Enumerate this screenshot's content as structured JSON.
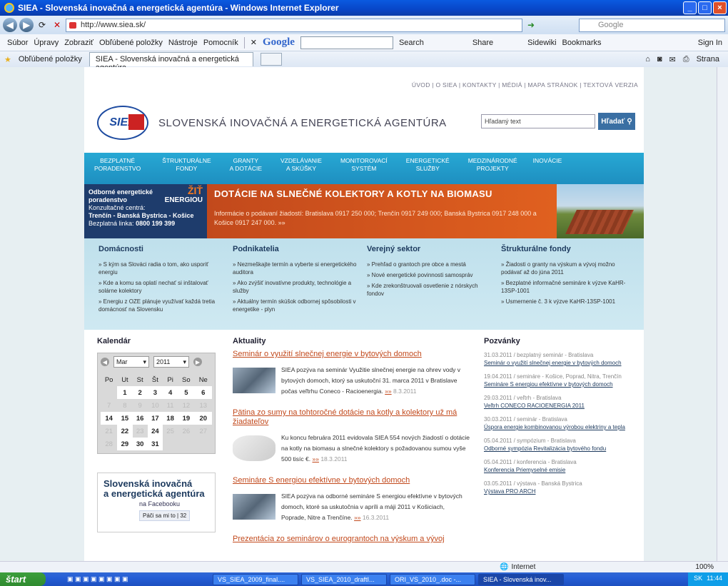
{
  "window": {
    "title": "SIEA - Slovenská inovačná a energetická agentúra - Windows Internet Explorer"
  },
  "address": {
    "url": "http://www.siea.sk/",
    "search_placeholder": "Google"
  },
  "menu": [
    "Súbor",
    "Úpravy",
    "Zobraziť",
    "Obľúbené položky",
    "Nástroje",
    "Pomocník"
  ],
  "google_toolbar": {
    "brand": "Google",
    "search": "Search",
    "share": "Share",
    "sidewiki": "Sidewiki",
    "bookmarks": "Bookmarks",
    "signin": "Sign In"
  },
  "favorites": {
    "label": "Obľúbené položky",
    "tab": "SIEA - Slovenská inovačná a energetická agentúra",
    "page": "Strana"
  },
  "site": {
    "topnav": "ÚVOD | O SIEA | KONTAKTY | MÉDIÁ | MAPA STRÁNOK | TEXTOVÁ VERZIA",
    "logo": "SIEA",
    "org": "SLOVENSKÁ INOVAČNÁ A ENERGETICKÁ AGENTÚRA",
    "search_text": "Hľadaný text",
    "search_btn": "Hľadať",
    "nav": [
      {
        "l1": "BEZPLATNÉ",
        "l2": "PORADENSTVO"
      },
      {
        "l1": "ŠTRUKTURÁLNE",
        "l2": "FONDY"
      },
      {
        "l1": "GRANTY",
        "l2": "A DOTÁCIE"
      },
      {
        "l1": "VZDELÁVANIE",
        "l2": "A SKÚŠKY"
      },
      {
        "l1": "MONITOROVACÍ",
        "l2": "SYSTÉM"
      },
      {
        "l1": "ENERGETICKÉ",
        "l2": "SLUŽBY"
      },
      {
        "l1": "MEDZINÁRODNÉ",
        "l2": "PROJEKTY"
      },
      {
        "l1": "INOVÁCIE",
        "l2": ""
      }
    ],
    "banner_left": {
      "l1": "Odborné energetické",
      "l2": "poradenstvo",
      "l3": "Konzultačné centrá:",
      "l4": "Trenčín - Banská Bystrica - Košice",
      "l5": "Bezplatná linka:",
      "phone": "0800 199 399",
      "zit1": "ŽIŤ",
      "zit2": "ENERGIOU"
    },
    "banner": {
      "title": "DOTÁCIE NA SLNEČNÉ KOLEKTORY A KOTLY NA BIOMASU",
      "text": "Informácie o podávaní žiadostí: Bratislava 0917 250 000; Trenčín 0917 249 000; Banská Bystrica 0917 248 000 a Košice 0917 247 000. »»"
    },
    "sectors": [
      {
        "title": "Domácnosti",
        "items": [
          "» S kým sa Slováci radia o tom, ako usporiť energiu",
          "» Kde a komu sa oplatí nechať si inštalovať solárne kolektory",
          "» Energiu z OZE plánuje využívať každá tretia domácnosť na Slovensku"
        ]
      },
      {
        "title": "Podnikatelia",
        "items": [
          "» Nezmeškajte termín a vyberte si energetického auditora",
          "» Ako zvýšiť inovatívne produkty, technológie a služby",
          "» Aktuálny termín skúšok odbornej spôsobilosti v energetike - plyn"
        ]
      },
      {
        "title": "Verejný sektor",
        "items": [
          "» Prehľad o grantoch pre obce a mestá",
          "» Nové energetické povinnosti samospráv",
          "» Kde zrekonštruovali osvetlenie z nórskych fondov"
        ]
      },
      {
        "title": "Štrukturálne fondy",
        "items": [
          "» Žiadosti o granty na výskum a vývoj možno podávať až do júna 2011",
          "» Bezplatné informačné semináre k výzve KaHR-13SP-1001",
          "» Usmernenie č. 3 k výzve KaHR-13SP-1001"
        ]
      }
    ],
    "calendar": {
      "title": "Kalendár",
      "month": "Mar",
      "year": "2011",
      "weekdays": [
        "Po",
        "Ut",
        "St",
        "Št",
        "Pi",
        "So",
        "Ne"
      ],
      "weeks": [
        [
          "",
          "1",
          "2",
          "3",
          "4",
          "5",
          "6"
        ],
        [
          "7",
          "8",
          "9",
          "10",
          "11",
          "12",
          "13"
        ],
        [
          "14",
          "15",
          "16",
          "17",
          "18",
          "19",
          "20"
        ],
        [
          "21",
          "22",
          "23",
          "24",
          "25",
          "26",
          "27"
        ],
        [
          "28",
          "29",
          "30",
          "31",
          "",
          "",
          ""
        ]
      ]
    },
    "facebook": {
      "t1": "Slovenská inovačná",
      "t2": "a energetická agentúra",
      "sub": "na Facebooku",
      "like": "Páči sa mi to",
      "count": "32"
    },
    "news": {
      "title": "Aktuality",
      "items": [
        {
          "h": "Seminár o využití slnečnej energie v bytových domoch",
          "p": "SIEA pozýva na seminár Využitie slnečnej energie na ohrev vody v bytových domoch, ktorý sa uskutoční 31. marca 2011 v Bratislave počas veľtrhu Coneco - Racioenergia.",
          "more": "»»",
          "date": "8.3.2011"
        },
        {
          "h": "Pätina zo sumy na tohtoročné dotácie na kotly a kolektory už má žiadateľov",
          "p": "Ku koncu februára 2011 evidovala SIEA 554 nových žiadostí o dotácie na kotly na biomasu a slnečné kolektory s požadovanou sumou vyše 500 tisíc €.",
          "more": "»»",
          "date": "18.3.2011"
        },
        {
          "h": "Semináre S energiou efektívne v bytových domoch",
          "p": "SIEA pozýva na odborné semináre S energiou efektívne v bytových domoch, ktoré sa uskutočnia v apríli a máji 2011 v Košiciach, Poprade, Nitre a Trenčíne.",
          "more": "»»",
          "date": "16.3.2011"
        },
        {
          "h": "Prezentácia zo seminárov o eurograntoch na výskum a vývoj",
          "p": "",
          "more": "",
          "date": ""
        }
      ]
    },
    "invitations": {
      "title": "Pozvánky",
      "items": [
        {
          "d": "31.03.2011 / bezplatný seminár - Bratislava",
          "l": "Seminár o využití slnečnej energie v bytových domoch"
        },
        {
          "d": "19.04.2011 / semináre - Košice, Poprad, Nitra, Trenčín",
          "l": "Semináre S energiou efektívne v bytových domoch"
        },
        {
          "d": "29.03.2011 / veľtrh - Bratislava",
          "l": "Veľtrh CONECO RACIOENERGIA 2011"
        },
        {
          "d": "30.03.2011 / seminár - Bratislava",
          "l": "Úspora energie kombinovanou výrobou elektriny a tepla"
        },
        {
          "d": "05.04.2011 / sympózium - Bratislava",
          "l": "Odborné sympózia Revitalizácia bytového fondu"
        },
        {
          "d": "05.04.2011 / konferencia - Bratislava",
          "l": "Konferencia Priemyselné emisie"
        },
        {
          "d": "03.05.2011 / výstava - Banská Bystrica",
          "l": "Výstava PRO ARCH"
        }
      ]
    }
  },
  "status": {
    "zone": "Internet",
    "zoom": "100%"
  },
  "taskbar": {
    "start": "štart",
    "tasks": [
      "VS_SIEA_2009_final....",
      "VS_SIEA_2010_draftI...",
      "ORI_VS_2010_.doc -...",
      "SIEA - Slovenská inov..."
    ],
    "lang": "SK",
    "time": "11:44"
  }
}
